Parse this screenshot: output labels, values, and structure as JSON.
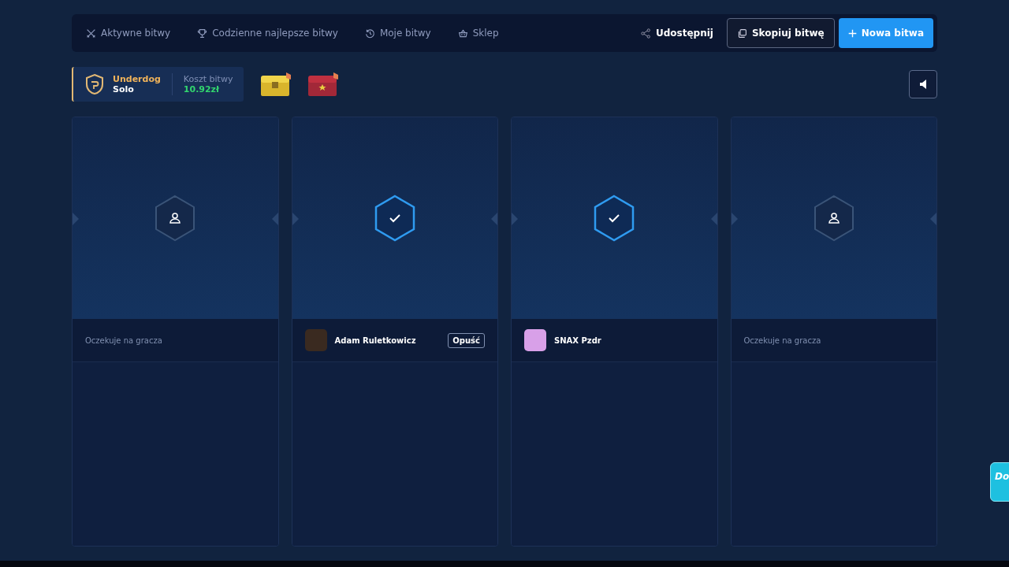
{
  "nav": {
    "tabs": [
      {
        "label": "Aktywne bitwy"
      },
      {
        "label": "Codzienne najlepsze bitwy"
      },
      {
        "label": "Moje bitwy"
      },
      {
        "label": "Sklep"
      }
    ],
    "share": "Udostępnij",
    "copy": "Skopiuj bitwę",
    "new": "Nowa bitwa"
  },
  "battle": {
    "mode": "Underdog",
    "type": "Solo",
    "cost_label": "Koszt bitwy",
    "cost": "10.92zł"
  },
  "slots": [
    {
      "kind": "empty",
      "ready": false,
      "label": "Oczekuje na gracza"
    },
    {
      "kind": "player",
      "ready": true,
      "name": "Adam Ruletkowicz",
      "leave": "Opuść"
    },
    {
      "kind": "player",
      "ready": true,
      "name": "SNAX Pzdr"
    },
    {
      "kind": "empty",
      "ready": false,
      "label": "Oczekuje na gracza"
    }
  ],
  "chat_chip": "Do"
}
